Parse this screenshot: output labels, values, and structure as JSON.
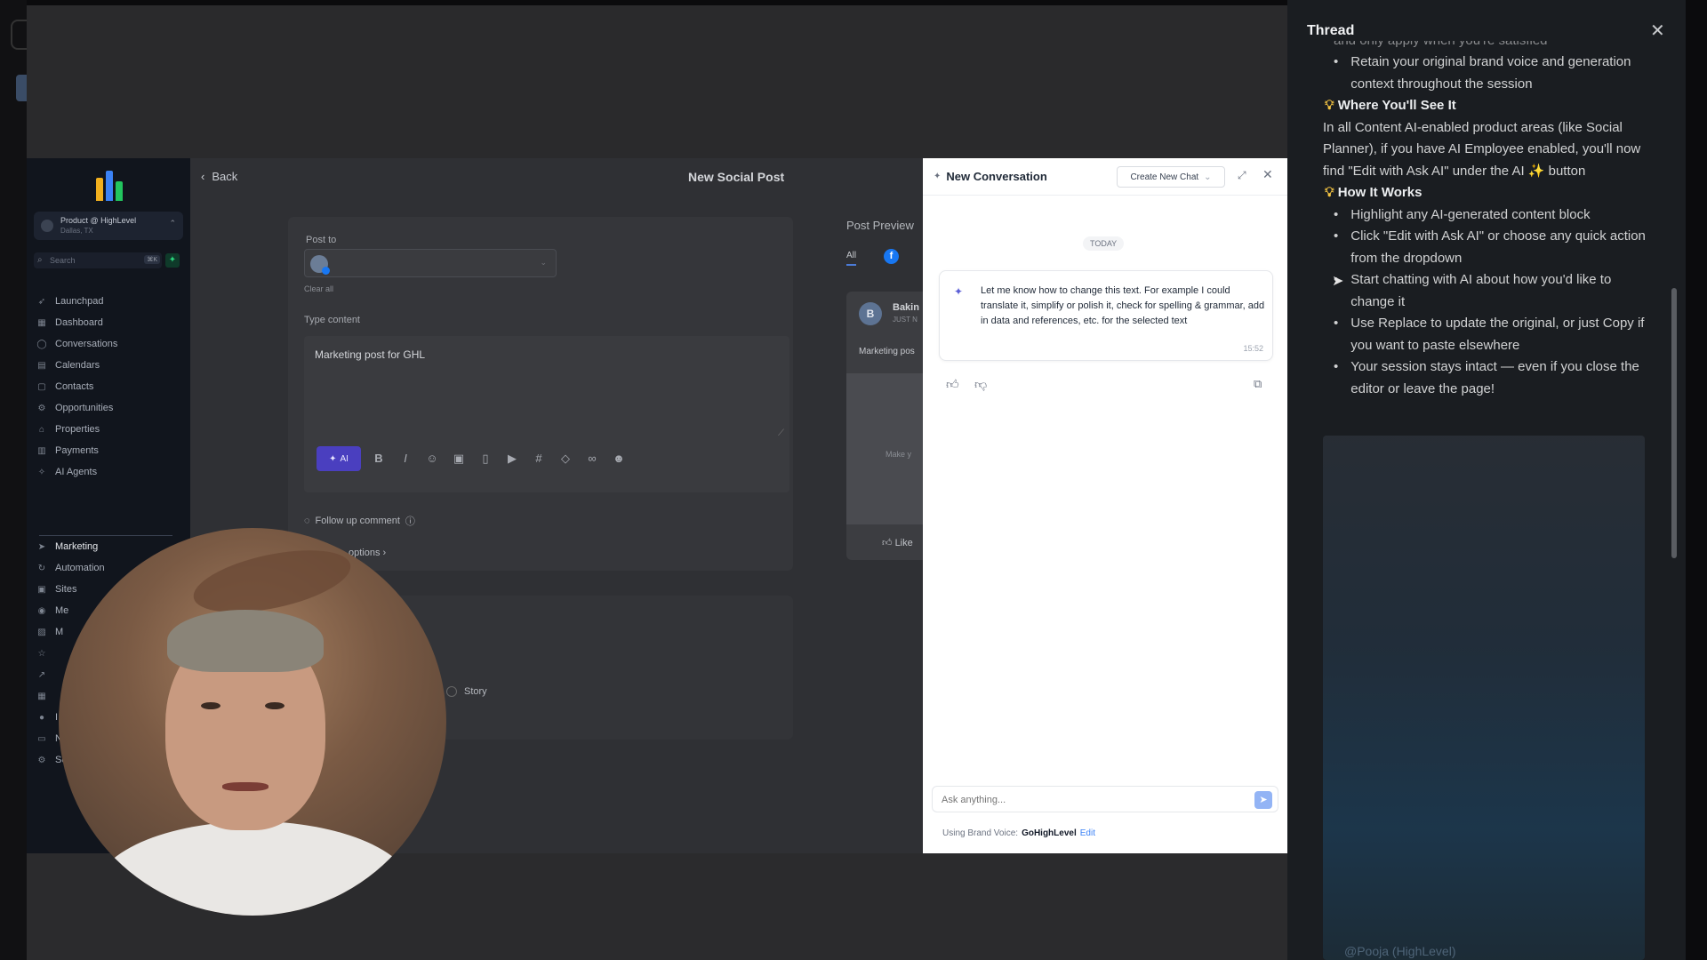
{
  "sidebar": {
    "workspace_name": "Product @ HighLevel",
    "workspace_location": "Dallas, TX",
    "search_placeholder": "Search",
    "search_shortcut": "⌘K",
    "items": [
      {
        "label": "Launchpad",
        "icon": "rocket-icon"
      },
      {
        "label": "Dashboard",
        "icon": "dashboard-icon"
      },
      {
        "label": "Conversations",
        "icon": "chat-icon"
      },
      {
        "label": "Calendars",
        "icon": "calendar-icon"
      },
      {
        "label": "Contacts",
        "icon": "contacts-icon"
      },
      {
        "label": "Opportunities",
        "icon": "opportunities-icon"
      },
      {
        "label": "Properties",
        "icon": "properties-icon"
      },
      {
        "label": "Payments",
        "icon": "payments-icon"
      },
      {
        "label": "AI Agents",
        "icon": "ai-agents-icon"
      }
    ],
    "items_lower": [
      {
        "label": "Marketing",
        "icon": "send-icon"
      },
      {
        "label": "Automation",
        "icon": "automation-icon"
      },
      {
        "label": "Sites",
        "icon": "sites-icon"
      },
      {
        "label": "Me",
        "icon": "memberships-icon"
      },
      {
        "label": "M",
        "icon": "media-icon"
      },
      {
        "label": "",
        "icon": "star-icon"
      },
      {
        "label": "",
        "icon": "reporting-icon"
      },
      {
        "label": "",
        "icon": "apps-icon"
      },
      {
        "label": "I",
        "icon": "info-icon"
      },
      {
        "label": "No",
        "icon": "notifications-icon"
      },
      {
        "label": "Settings",
        "icon": "settings-icon"
      }
    ]
  },
  "editor": {
    "back_label": "Back",
    "title": "New Social Post",
    "post_to_label": "Post to",
    "clear_all": "Clear all",
    "type_content_label": "Type content",
    "content_value": "Marketing post for GHL",
    "ai_button": "AI",
    "followup_label": "Follow up comment",
    "options_label": "options",
    "story_label": "Story"
  },
  "preview": {
    "title": "Post Preview",
    "tab_all": "All",
    "account_initial": "B",
    "account_name": "Bakin",
    "time": "JUST N",
    "post_text": "Marketing pos",
    "media_text": "Make y",
    "like_label": "Like"
  },
  "chat": {
    "title": "New Conversation",
    "new_chat_button": "Create New Chat",
    "today": "TODAY",
    "message": "Let me know how to change this text. For example I could translate it, simplify or polish it, check for spelling & grammar, add in data and references, etc. for the selected text",
    "message_time": "15:52",
    "input_placeholder": "Ask anything...",
    "brand_voice_prefix": "Using Brand Voice:",
    "brand_voice_name": "GoHighLevel",
    "brand_voice_edit": "Edit"
  },
  "thread": {
    "title": "Thread",
    "partial_top": "and only apply when you're satisfied",
    "bullets_1": [
      "Retain your original brand voice and generation context throughout the session"
    ],
    "heading_where": "Where You'll See It",
    "para_where": "In all Content AI-enabled product areas (like Social Planner), if you have AI Employee enabled, you'll now find \"Edit with Ask AI\" under the AI ✨ button",
    "heading_how": "How It Works",
    "bullets_how": [
      "Highlight any AI-generated content block",
      "Click \"Edit with Ask AI\" or choose any quick action from the dropdown",
      "Start chatting with AI about how you'd like to change it",
      "Use Replace to update the original, or just Copy if you want to paste elsewhere",
      "Your session stays intact — even if you close the editor or leave the page!"
    ],
    "footer_partial": "@Pooja (HighLevel)"
  },
  "colors": {
    "accent_ai": "#4a3fbf",
    "facebook_blue": "#1877f2",
    "link_blue": "#3b82f6"
  }
}
